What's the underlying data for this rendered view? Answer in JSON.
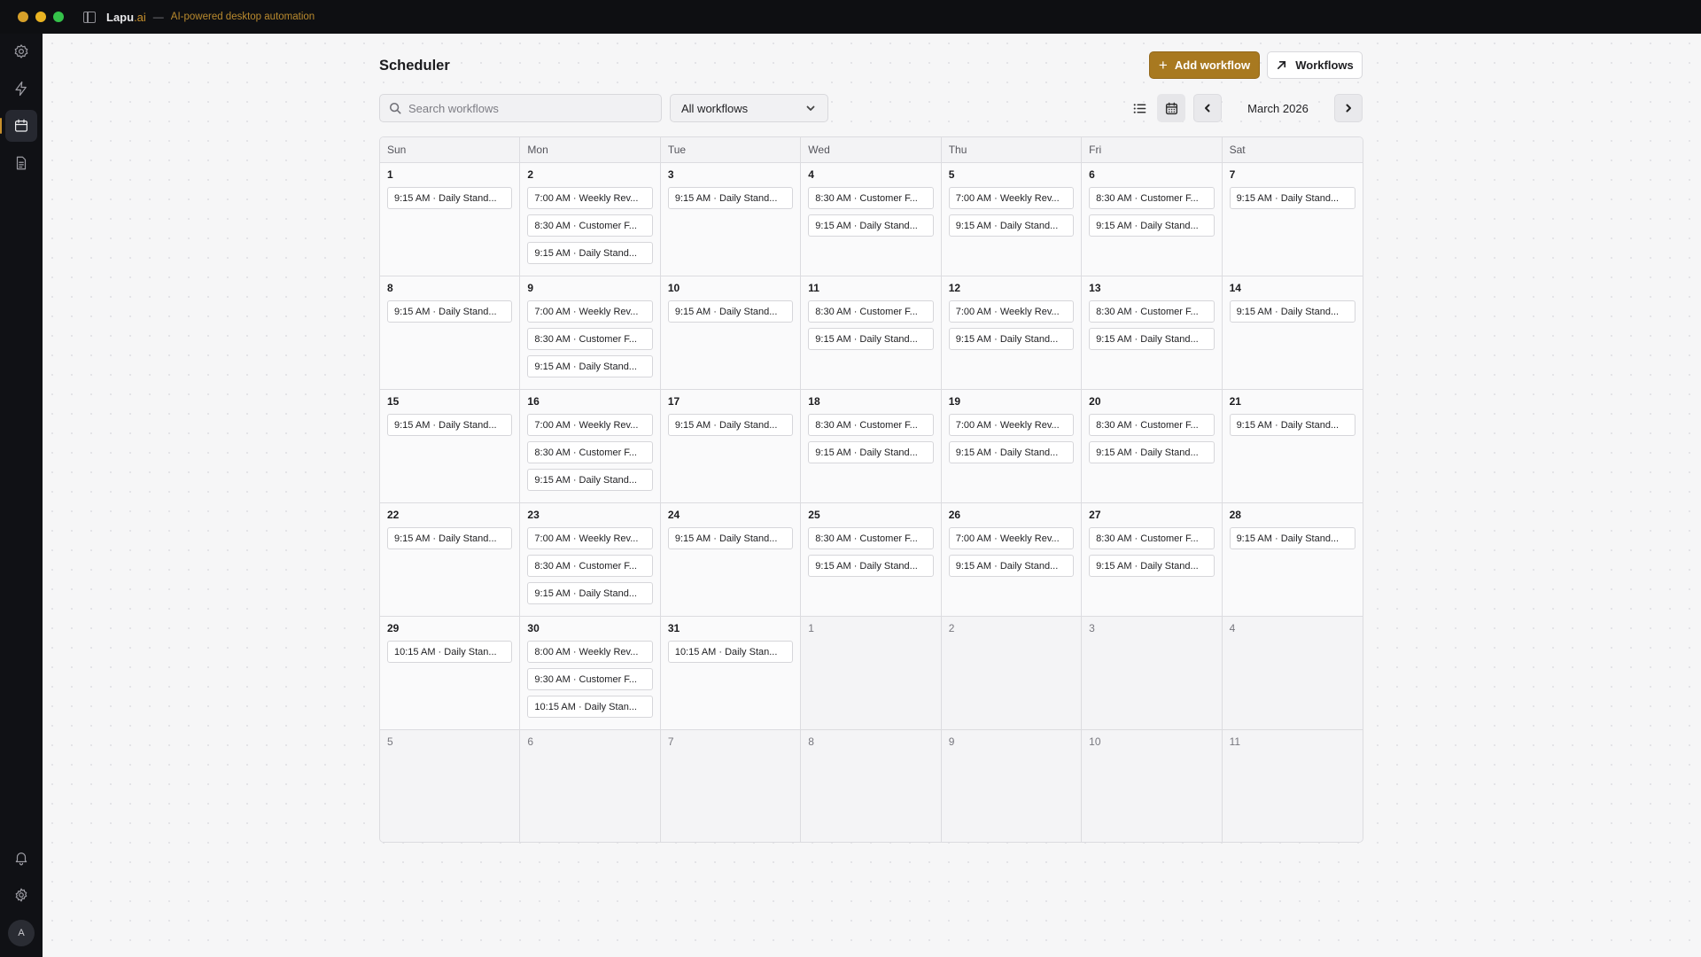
{
  "app": {
    "brand_name": "Lapu",
    "brand_suffix": ".ai",
    "separator": "—",
    "tagline": "AI-powered desktop automation"
  },
  "sidebar": {
    "items": [
      {
        "name": "workflows-logo",
        "icon": "gear-logo-icon",
        "active": false
      },
      {
        "name": "automations",
        "icon": "lightning-icon",
        "active": false
      },
      {
        "name": "scheduler",
        "icon": "calendar-icon",
        "active": true
      },
      {
        "name": "documents",
        "icon": "document-icon",
        "active": false
      }
    ],
    "bottom": [
      {
        "name": "notifications",
        "icon": "bell-icon"
      },
      {
        "name": "settings",
        "icon": "gear-icon"
      }
    ],
    "avatar_initial": "A"
  },
  "header": {
    "title": "Scheduler",
    "add_button": "Add workflow",
    "workflows_button": "Workflows"
  },
  "toolbar": {
    "search_placeholder": "Search workflows",
    "filter_value": "All workflows",
    "month_label": "March 2026"
  },
  "calendar": {
    "weekdays": [
      "Sun",
      "Mon",
      "Tue",
      "Wed",
      "Thu",
      "Fri",
      "Sat"
    ],
    "weeks": [
      [
        {
          "day": "1",
          "other": false,
          "events": [
            "9:15 AM · Daily Stand..."
          ]
        },
        {
          "day": "2",
          "other": false,
          "events": [
            "7:00 AM · Weekly Rev...",
            "8:30 AM · Customer F...",
            "9:15 AM · Daily Stand..."
          ]
        },
        {
          "day": "3",
          "other": false,
          "events": [
            "9:15 AM · Daily Stand..."
          ]
        },
        {
          "day": "4",
          "other": false,
          "events": [
            "8:30 AM · Customer F...",
            "9:15 AM · Daily Stand..."
          ]
        },
        {
          "day": "5",
          "other": false,
          "events": [
            "7:00 AM · Weekly Rev...",
            "9:15 AM · Daily Stand..."
          ]
        },
        {
          "day": "6",
          "other": false,
          "events": [
            "8:30 AM · Customer F...",
            "9:15 AM · Daily Stand..."
          ]
        },
        {
          "day": "7",
          "other": false,
          "events": [
            "9:15 AM · Daily Stand..."
          ]
        }
      ],
      [
        {
          "day": "8",
          "other": false,
          "events": [
            "9:15 AM · Daily Stand..."
          ]
        },
        {
          "day": "9",
          "other": false,
          "events": [
            "7:00 AM · Weekly Rev...",
            "8:30 AM · Customer F...",
            "9:15 AM · Daily Stand..."
          ]
        },
        {
          "day": "10",
          "other": false,
          "events": [
            "9:15 AM · Daily Stand..."
          ]
        },
        {
          "day": "11",
          "other": false,
          "events": [
            "8:30 AM · Customer F...",
            "9:15 AM · Daily Stand..."
          ]
        },
        {
          "day": "12",
          "other": false,
          "events": [
            "7:00 AM · Weekly Rev...",
            "9:15 AM · Daily Stand..."
          ]
        },
        {
          "day": "13",
          "other": false,
          "events": [
            "8:30 AM · Customer F...",
            "9:15 AM · Daily Stand..."
          ]
        },
        {
          "day": "14",
          "other": false,
          "events": [
            "9:15 AM · Daily Stand..."
          ]
        }
      ],
      [
        {
          "day": "15",
          "other": false,
          "events": [
            "9:15 AM · Daily Stand..."
          ]
        },
        {
          "day": "16",
          "other": false,
          "events": [
            "7:00 AM · Weekly Rev...",
            "8:30 AM · Customer F...",
            "9:15 AM · Daily Stand..."
          ]
        },
        {
          "day": "17",
          "other": false,
          "events": [
            "9:15 AM · Daily Stand..."
          ]
        },
        {
          "day": "18",
          "other": false,
          "events": [
            "8:30 AM · Customer F...",
            "9:15 AM · Daily Stand..."
          ]
        },
        {
          "day": "19",
          "other": false,
          "events": [
            "7:00 AM · Weekly Rev...",
            "9:15 AM · Daily Stand..."
          ]
        },
        {
          "day": "20",
          "other": false,
          "events": [
            "8:30 AM · Customer F...",
            "9:15 AM · Daily Stand..."
          ]
        },
        {
          "day": "21",
          "other": false,
          "events": [
            "9:15 AM · Daily Stand..."
          ]
        }
      ],
      [
        {
          "day": "22",
          "other": false,
          "events": [
            "9:15 AM · Daily Stand..."
          ]
        },
        {
          "day": "23",
          "other": false,
          "events": [
            "7:00 AM · Weekly Rev...",
            "8:30 AM · Customer F...",
            "9:15 AM · Daily Stand..."
          ]
        },
        {
          "day": "24",
          "other": false,
          "events": [
            "9:15 AM · Daily Stand..."
          ]
        },
        {
          "day": "25",
          "other": false,
          "events": [
            "8:30 AM · Customer F...",
            "9:15 AM · Daily Stand..."
          ]
        },
        {
          "day": "26",
          "other": false,
          "events": [
            "7:00 AM · Weekly Rev...",
            "9:15 AM · Daily Stand..."
          ]
        },
        {
          "day": "27",
          "other": false,
          "events": [
            "8:30 AM · Customer F...",
            "9:15 AM · Daily Stand..."
          ]
        },
        {
          "day": "28",
          "other": false,
          "events": [
            "9:15 AM · Daily Stand..."
          ]
        }
      ],
      [
        {
          "day": "29",
          "other": false,
          "events": [
            "10:15 AM · Daily Stan..."
          ]
        },
        {
          "day": "30",
          "other": false,
          "events": [
            "8:00 AM · Weekly Rev...",
            "9:30 AM · Customer F...",
            "10:15 AM · Daily Stan..."
          ]
        },
        {
          "day": "31",
          "other": false,
          "events": [
            "10:15 AM · Daily Stan..."
          ]
        },
        {
          "day": "1",
          "other": true,
          "events": []
        },
        {
          "day": "2",
          "other": true,
          "events": []
        },
        {
          "day": "3",
          "other": true,
          "events": []
        },
        {
          "day": "4",
          "other": true,
          "events": []
        }
      ],
      [
        {
          "day": "5",
          "other": true,
          "events": []
        },
        {
          "day": "6",
          "other": true,
          "events": []
        },
        {
          "day": "7",
          "other": true,
          "events": []
        },
        {
          "day": "8",
          "other": true,
          "events": []
        },
        {
          "day": "9",
          "other": true,
          "events": []
        },
        {
          "day": "10",
          "other": true,
          "events": []
        },
        {
          "day": "11",
          "other": true,
          "events": []
        }
      ]
    ]
  },
  "colors": {
    "accent": "#a87920",
    "titlebar_bg": "#0e0f12",
    "sidebar_bg": "#101115"
  }
}
